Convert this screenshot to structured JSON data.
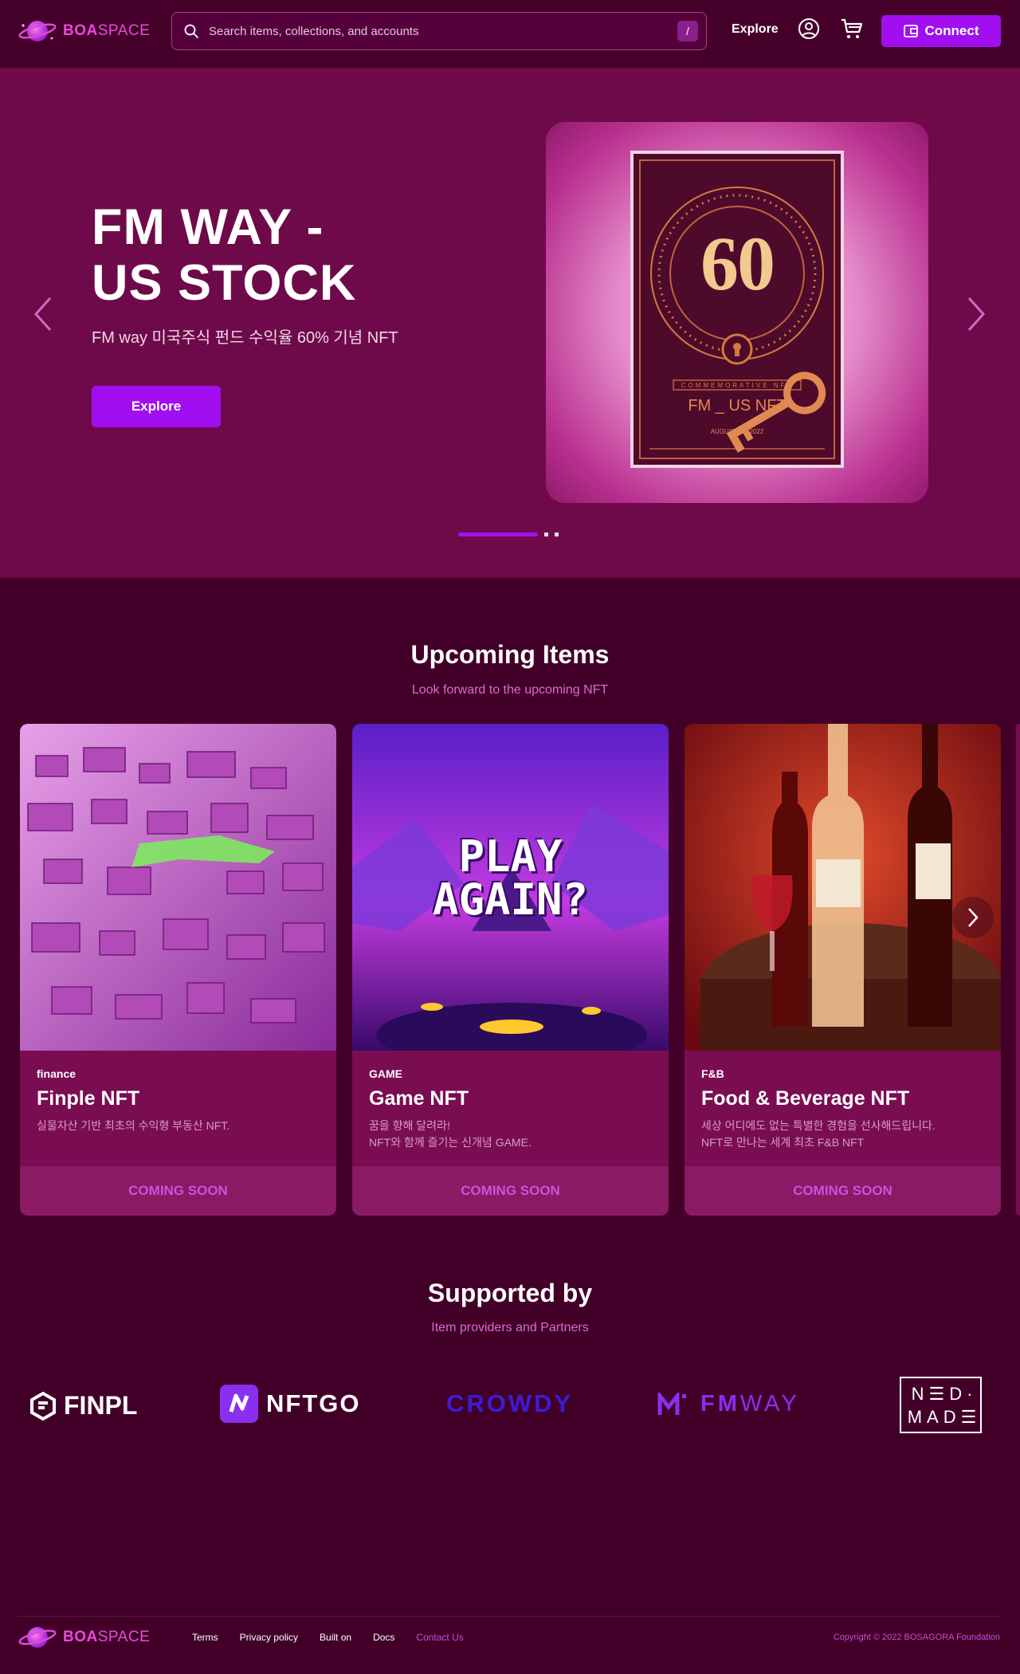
{
  "brand": {
    "name_bold": "BOA",
    "name_rest": "SPACE"
  },
  "nav": {
    "search_placeholder": "Search items, collections, and accounts",
    "search_shortcut": "/",
    "explore": "Explore",
    "connect": "Connect"
  },
  "hero": {
    "title": "FM WAY -\nUS STOCK",
    "subtitle": "FM way 미국주식 펀드 수익율 60% 기념 NFT",
    "button": "Explore",
    "card": {
      "number": "60",
      "caption": "COMMEMORATIVE NFT",
      "name": "FM _ US NFT",
      "date": "AUGUST 01, 2022"
    },
    "slides_total": 3,
    "active_slide": 1
  },
  "upcoming": {
    "title": "Upcoming Items",
    "subtitle": "Look forward to the upcoming NFT",
    "items": [
      {
        "category": "finance",
        "title": "Finple NFT",
        "desc": "실물자산 기반 최초의 수익형 부동산 NFT.",
        "button": "COMING SOON"
      },
      {
        "category": "GAME",
        "title": "Game NFT",
        "desc": "꿈을 향해 달려라!\nNFT와 함께 즐기는 신개념 GAME.",
        "button": "COMING SOON",
        "image_text": [
          "PLAY",
          "AGAIN?"
        ]
      },
      {
        "category": "F&B",
        "title": "Food & Beverage NFT",
        "desc": "세상 어디에도 없는 특별한 경험을 선사해드립니다.\nNFT로 만나는 세계 최초 F&B NFT",
        "button": "COMING SOON"
      }
    ]
  },
  "supported": {
    "title": "Supported by",
    "subtitle": "Item providers and Partners",
    "partners": {
      "finpl": "FINPL",
      "nftgo": "NFTGO",
      "crowdy": "CROWDY",
      "fmway_a": "FM",
      "fmway_b": "WAY",
      "needmade_1": "N☰D·",
      "needmade_2": "MAD☰"
    }
  },
  "footer": {
    "links": [
      "Terms",
      "Privacy policy",
      "Built on",
      "Docs",
      "Contact Us"
    ],
    "copyright": "Copyright © 2022 BOSAGORA Foundation"
  },
  "colors": {
    "accent": "#a10ff0",
    "bg": "#420028",
    "hero_bg": "#6e0a49",
    "card_bg": "#7a0d52",
    "pink_text": "#d86bd0"
  }
}
